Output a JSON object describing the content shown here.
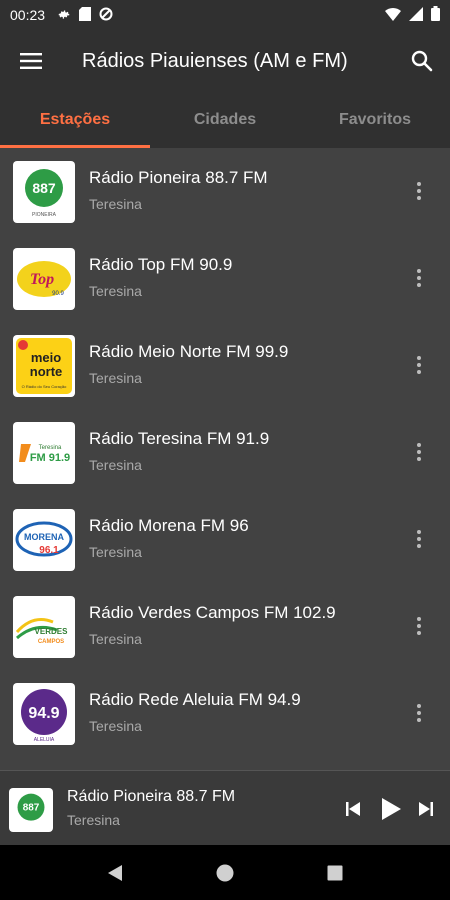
{
  "status": {
    "time": "00:23"
  },
  "appbar": {
    "title": "Rádios Piauienses (AM e FM)"
  },
  "tabs": [
    {
      "label": "Estações",
      "active": true
    },
    {
      "label": "Cidades",
      "active": false
    },
    {
      "label": "Favoritos",
      "active": false
    }
  ],
  "stations": [
    {
      "name": "Rádio Pioneira 88.7 FM",
      "city": "Teresina",
      "logo_text": "887",
      "logo_sub": "PIONEIRA"
    },
    {
      "name": "Rádio Top FM 90.9",
      "city": "Teresina",
      "logo_text": "Top",
      "logo_sub": "90.9"
    },
    {
      "name": "Rádio Meio Norte FM 99.9",
      "city": "Teresina",
      "logo_text": "meio norte",
      "logo_sub": "O Rádio do Seu Coração"
    },
    {
      "name": "Rádio Teresina FM 91.9",
      "city": "Teresina",
      "logo_text": "FM 91.9",
      "logo_sub": "Teresina"
    },
    {
      "name": "Rádio Morena FM 96",
      "city": "Teresina",
      "logo_text": "MORENA",
      "logo_sub": "96.1"
    },
    {
      "name": "Rádio Verdes Campos FM 102.9",
      "city": "Teresina",
      "logo_text": "VERDES",
      "logo_sub": "CAMPOS"
    },
    {
      "name": "Rádio Rede Aleluia FM 94.9",
      "city": "Teresina",
      "logo_text": "94.9",
      "logo_sub": "ALELUIA"
    }
  ],
  "player": {
    "name": "Rádio Pioneira 88.7 FM",
    "city": "Teresina",
    "logo_text": "887"
  },
  "colors": {
    "accent": "#ff7043",
    "bar": "#303030",
    "list": "#424242"
  },
  "icons": {
    "menu": "menu-icon",
    "search": "search-icon",
    "more": "more-vert-icon",
    "prev": "skip-previous-icon",
    "play": "play-icon",
    "next": "skip-next-icon",
    "back": "nav-back-icon",
    "home": "nav-home-icon",
    "recents": "nav-recents-icon"
  }
}
